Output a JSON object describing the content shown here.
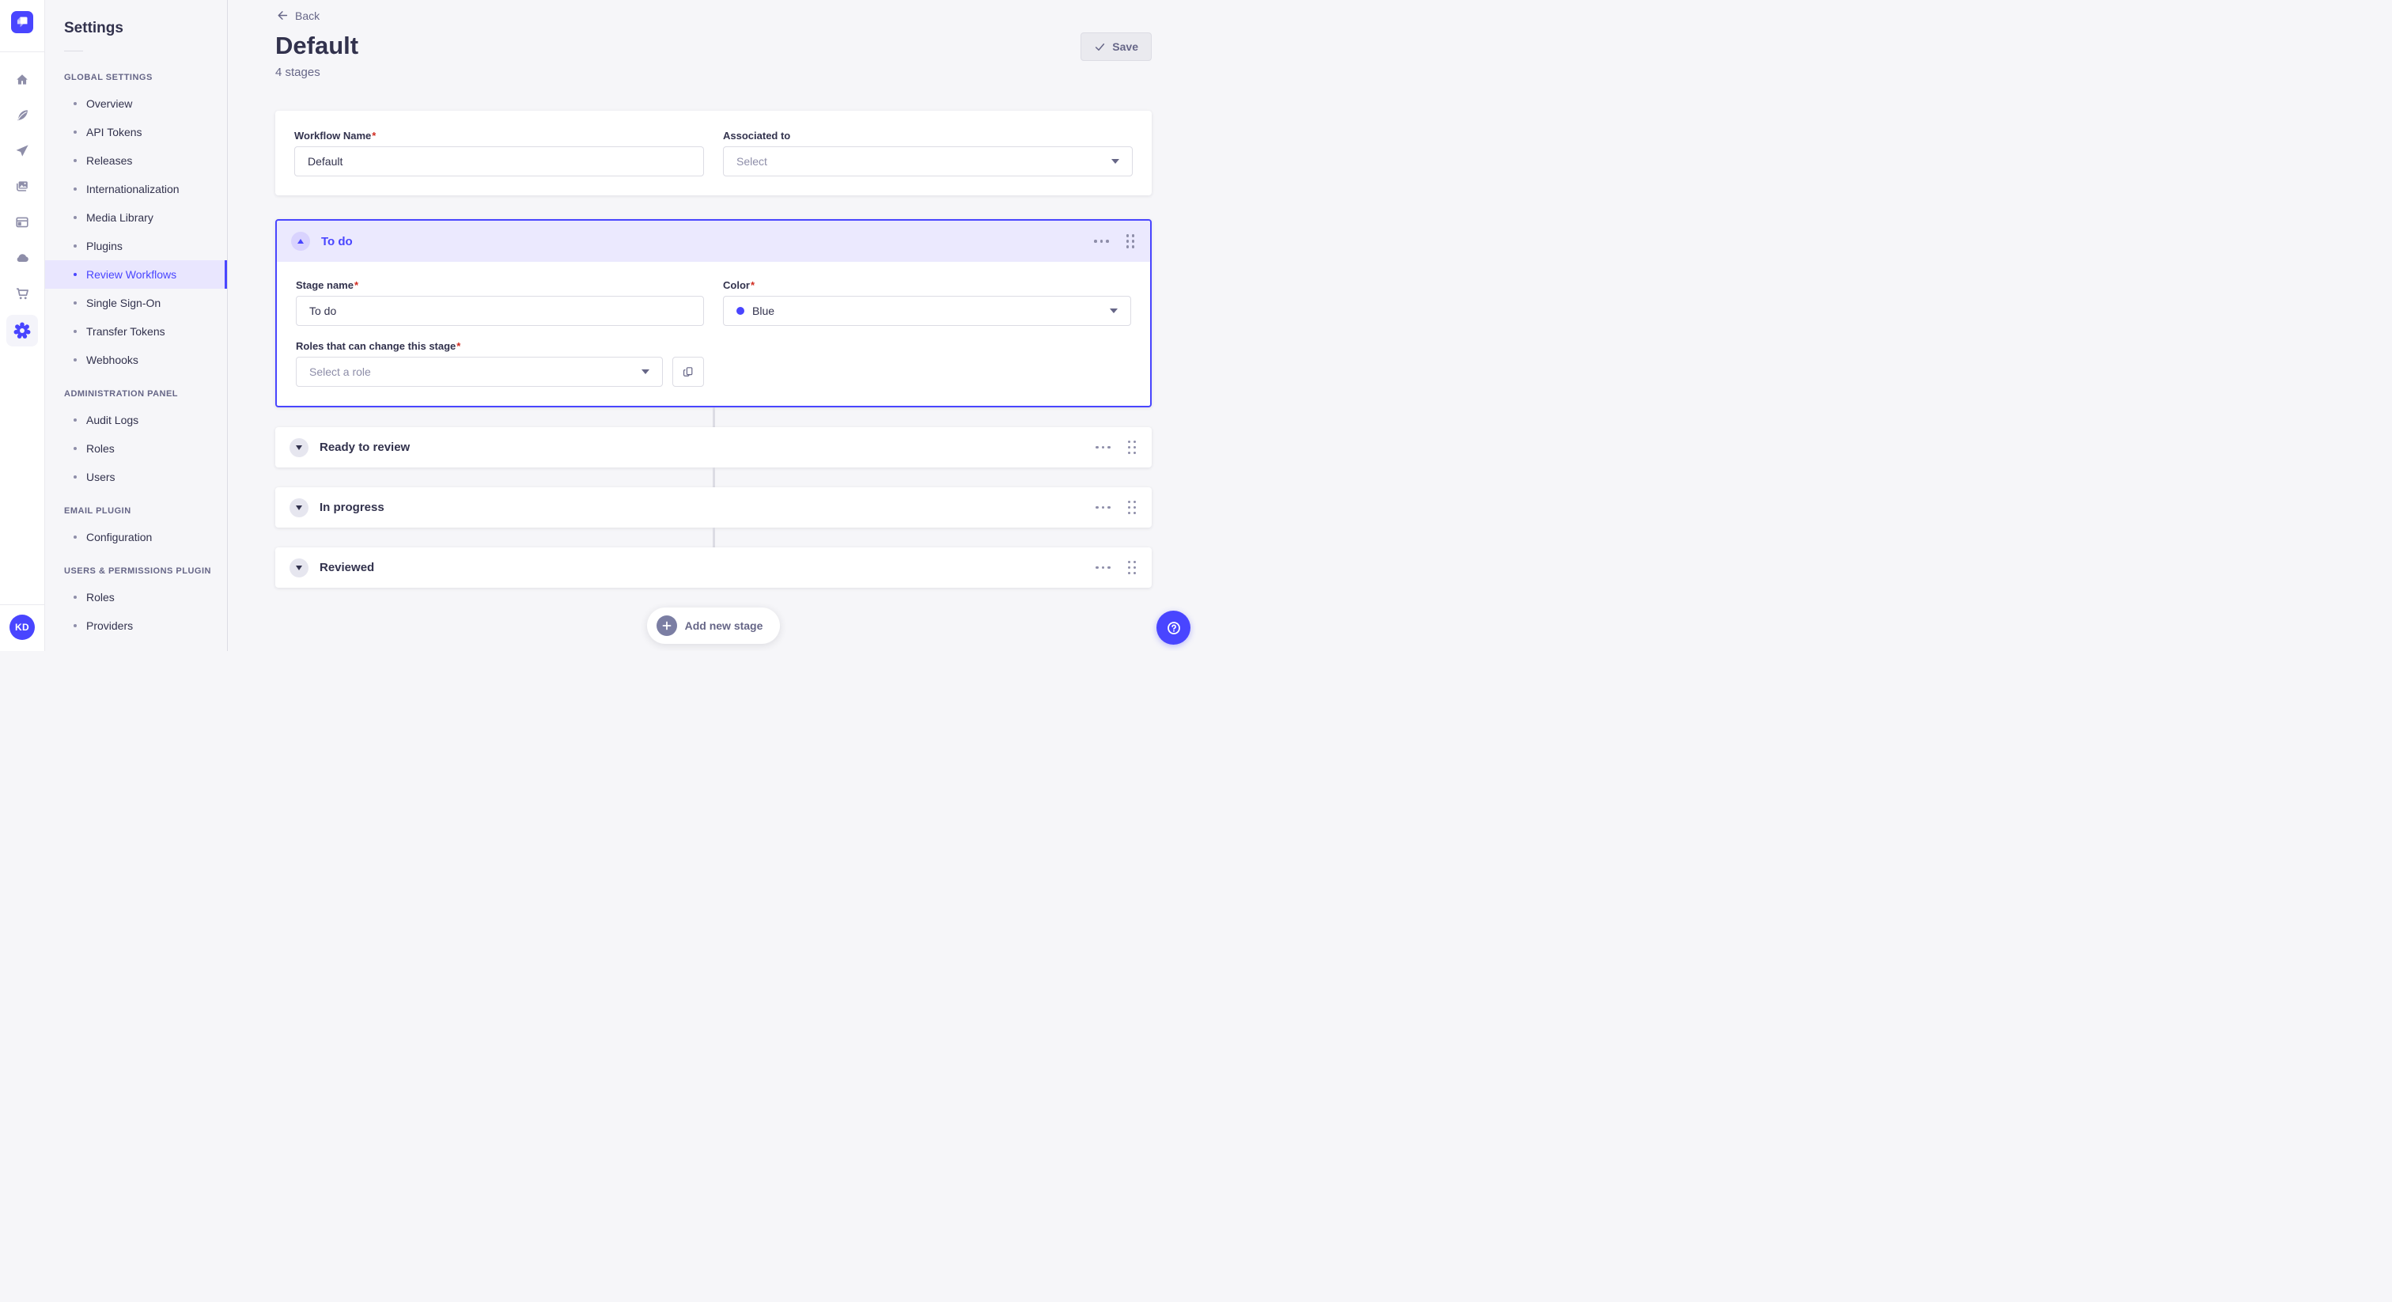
{
  "rail": {
    "avatar_initials": "KD",
    "icons": [
      "strapi-logo",
      "home",
      "content-manager",
      "releases",
      "media-library",
      "content-type-builder",
      "cloud",
      "marketplace",
      "settings"
    ]
  },
  "sidebar": {
    "title": "Settings",
    "sections": [
      {
        "label": "GLOBAL SETTINGS",
        "items": [
          {
            "label": "Overview"
          },
          {
            "label": "API Tokens"
          },
          {
            "label": "Releases"
          },
          {
            "label": "Internationalization"
          },
          {
            "label": "Media Library"
          },
          {
            "label": "Plugins"
          },
          {
            "label": "Review Workflows"
          },
          {
            "label": "Single Sign-On"
          },
          {
            "label": "Transfer Tokens"
          },
          {
            "label": "Webhooks"
          }
        ]
      },
      {
        "label": "ADMINISTRATION PANEL",
        "items": [
          {
            "label": "Audit Logs"
          },
          {
            "label": "Roles"
          },
          {
            "label": "Users"
          }
        ]
      },
      {
        "label": "EMAIL PLUGIN",
        "items": [
          {
            "label": "Configuration"
          }
        ]
      },
      {
        "label": "USERS & PERMISSIONS PLUGIN",
        "items": [
          {
            "label": "Roles"
          },
          {
            "label": "Providers"
          }
        ]
      }
    ]
  },
  "page": {
    "back": "Back",
    "title": "Default",
    "subtitle": "4 stages",
    "save": "Save"
  },
  "form": {
    "workflow_name": {
      "label": "Workflow Name",
      "required": "*",
      "value": "Default"
    },
    "associated_to": {
      "label": "Associated to",
      "placeholder": "Select"
    }
  },
  "stage_expanded": {
    "title": "To do",
    "stage_name": {
      "label": "Stage name",
      "required": "*",
      "value": "To do"
    },
    "color": {
      "label": "Color",
      "required": "*",
      "value": "Blue",
      "dot_hex": "#4945ff"
    },
    "roles": {
      "label": "Roles that can change this stage",
      "required": "*",
      "placeholder": "Select a role"
    }
  },
  "stages_collapsed": [
    {
      "title": "Ready to review"
    },
    {
      "title": "In progress"
    },
    {
      "title": "Reviewed"
    }
  ],
  "add_stage": {
    "label": "Add new stage"
  },
  "colors": {
    "primary": "#4945ff",
    "danger": "#d02b20",
    "background": "#f6f6f9"
  }
}
